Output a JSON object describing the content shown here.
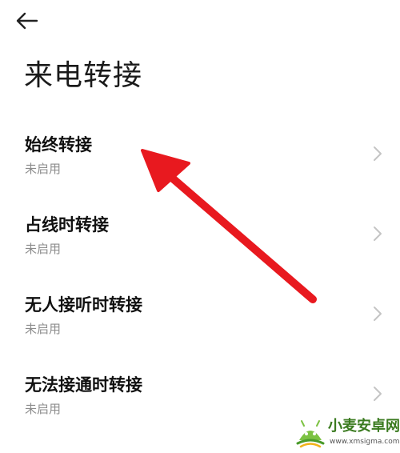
{
  "header": {
    "back_icon": "arrow-left-icon",
    "title": "来电转接"
  },
  "forwarding_options": [
    {
      "title": "始终转接",
      "status": "未启用"
    },
    {
      "title": "占线时转接",
      "status": "未启用"
    },
    {
      "title": "无人接听时转接",
      "status": "未启用"
    },
    {
      "title": "无法接通时转接",
      "status": "未启用"
    }
  ],
  "annotation": {
    "icon": "red-pointer-arrow",
    "color": "#e8191f"
  },
  "watermark": {
    "name": "小麦安卓网",
    "url": "www.xmsigma.com",
    "logo_icon": "android-robot-logo"
  },
  "colors": {
    "title": "#1a1a1a",
    "subtitle": "#8c8c8c",
    "chevron": "#c4c4c4",
    "background": "#ffffff"
  }
}
